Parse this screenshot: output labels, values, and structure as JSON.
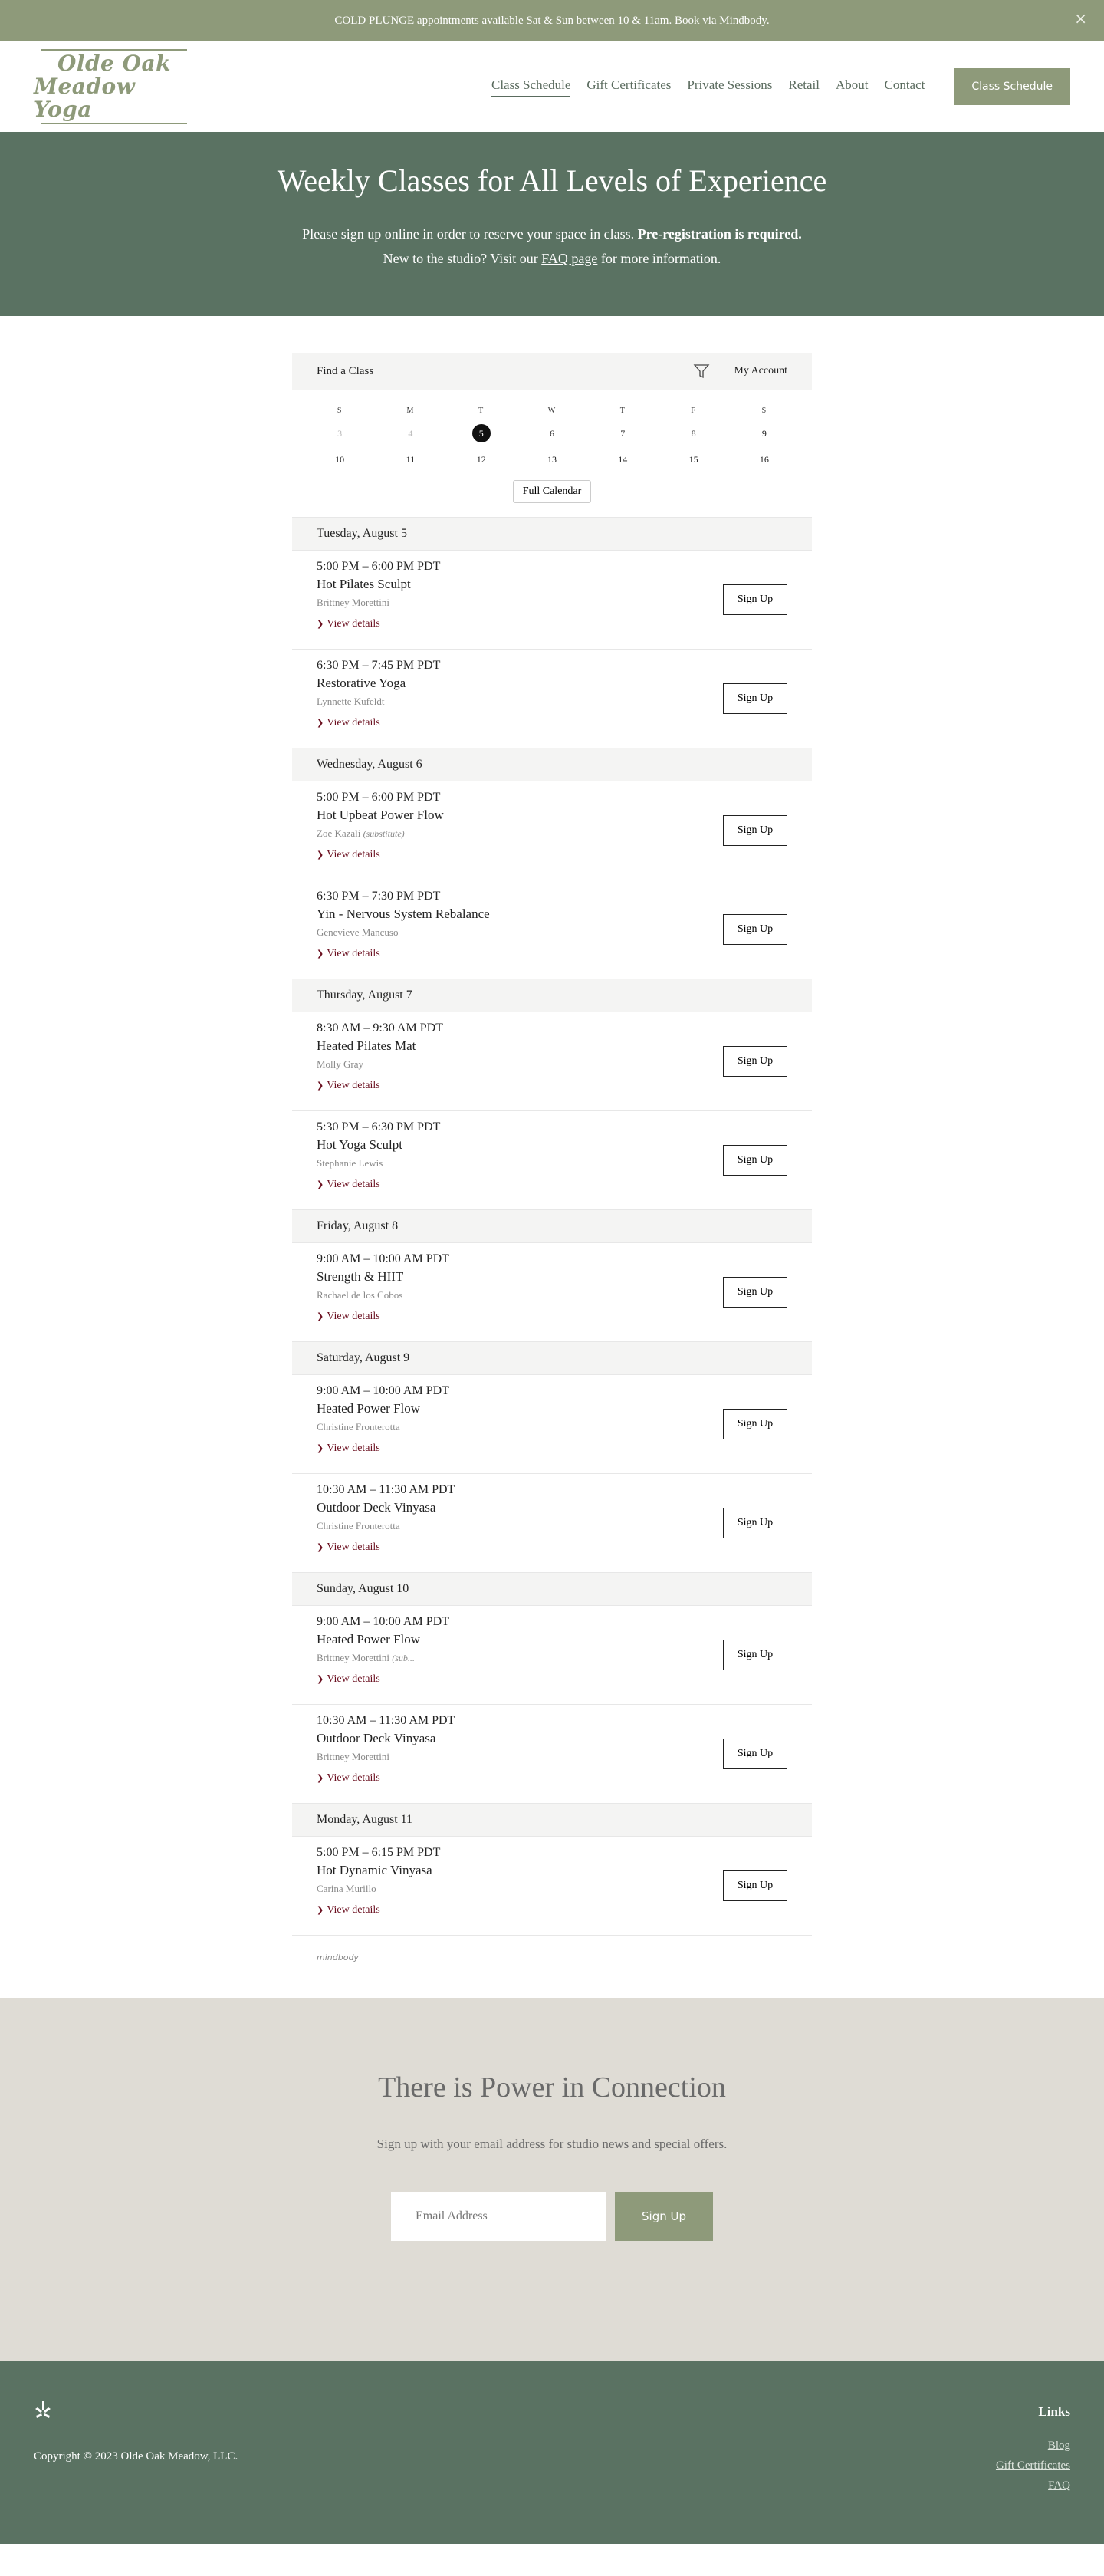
{
  "announcement": {
    "text": "COLD PLUNGE appointments available Sat & Sun between 10 & 11am. Book via Mindbody.",
    "close": "×"
  },
  "header": {
    "logo_line1": "Olde Oak",
    "logo_line2": "Meadow Yoga",
    "nav": [
      "Class Schedule",
      "Gift Certificates",
      "Private Sessions",
      "Retail",
      "About",
      "Contact"
    ],
    "cta": "Class Schedule"
  },
  "hero": {
    "title": "Weekly Classes for All Levels of Experience",
    "line1_plain": "Please sign up online in order to reserve your space in class. ",
    "line1_bold": "Pre-registration is required.",
    "line2_before": "New to the studio? Visit our ",
    "line2_link": "FAQ page",
    "line2_after": " for more information."
  },
  "widget": {
    "title": "Find a Class",
    "account": "My Account",
    "days_of_week": [
      "S",
      "M",
      "T",
      "W",
      "T",
      "F",
      "S"
    ],
    "week1": [
      "3",
      "4",
      "5",
      "6",
      "7",
      "8",
      "9"
    ],
    "week2": [
      "10",
      "11",
      "12",
      "13",
      "14",
      "15",
      "16"
    ],
    "full_calendar": "Full Calendar",
    "details_label": "View details",
    "signup_label": "Sign Up",
    "powered_by": "mindbody",
    "days": [
      {
        "heading": "Tuesday, August 5",
        "classes": [
          {
            "time": "5:00 PM – 6:00 PM PDT",
            "name": "Hot Pilates Sculpt",
            "teacher": "Brittney Morettini",
            "note": ""
          },
          {
            "time": "6:30 PM – 7:45 PM PDT",
            "name": "Restorative Yoga",
            "teacher": "Lynnette Kufeldt",
            "note": ""
          }
        ]
      },
      {
        "heading": "Wednesday, August 6",
        "classes": [
          {
            "time": "5:00 PM – 6:00 PM PDT",
            "name": "Hot Upbeat Power Flow",
            "teacher": "Zoe Kazali",
            "note": "(substitute)"
          },
          {
            "time": "6:30 PM – 7:30 PM PDT",
            "name": "Yin - Nervous System Rebalance",
            "teacher": "Genevieve Mancuso",
            "note": ""
          }
        ]
      },
      {
        "heading": "Thursday, August 7",
        "classes": [
          {
            "time": "8:30 AM – 9:30 AM PDT",
            "name": "Heated Pilates Mat",
            "teacher": "Molly Gray",
            "note": ""
          },
          {
            "time": "5:30 PM – 6:30 PM PDT",
            "name": "Hot Yoga Sculpt",
            "teacher": "Stephanie Lewis",
            "note": ""
          }
        ]
      },
      {
        "heading": "Friday, August 8",
        "classes": [
          {
            "time": "9:00 AM – 10:00 AM PDT",
            "name": "Strength & HIIT",
            "teacher": "Rachael de los Cobos",
            "note": ""
          }
        ]
      },
      {
        "heading": "Saturday, August 9",
        "classes": [
          {
            "time": "9:00 AM – 10:00 AM PDT",
            "name": "Heated Power Flow",
            "teacher": "Christine Fronterotta",
            "note": ""
          },
          {
            "time": "10:30 AM – 11:30 AM PDT",
            "name": "Outdoor Deck Vinyasa",
            "teacher": "Christine Fronterotta",
            "note": ""
          }
        ]
      },
      {
        "heading": "Sunday, August 10",
        "classes": [
          {
            "time": "9:00 AM – 10:00 AM PDT",
            "name": "Heated Power Flow",
            "teacher": "Brittney Morettini",
            "note": "(sub..."
          },
          {
            "time": "10:30 AM – 11:30 AM PDT",
            "name": "Outdoor Deck Vinyasa",
            "teacher": "Brittney Morettini",
            "note": ""
          }
        ]
      },
      {
        "heading": "Monday, August 11",
        "classes": [
          {
            "time": "5:00 PM – 6:15 PM PDT",
            "name": "Hot Dynamic Vinyasa",
            "teacher": "Carina Murillo",
            "note": ""
          }
        ]
      }
    ]
  },
  "newsletter": {
    "title": "There is Power in Connection",
    "subtitle": "Sign up with your email address for studio news and special offers.",
    "placeholder": "Email Address",
    "button": "Sign Up"
  },
  "footer": {
    "copyright": "Copyright © 2023 Olde Oak Meadow, LLC.",
    "links_heading": "Links",
    "links": [
      "Blog",
      "Gift Certificates",
      "FAQ"
    ]
  },
  "colors": {
    "sage": "#8e9a7a",
    "forest": "#5a7262",
    "sand": "#dfdcd5",
    "detail_link": "#6b1020"
  }
}
